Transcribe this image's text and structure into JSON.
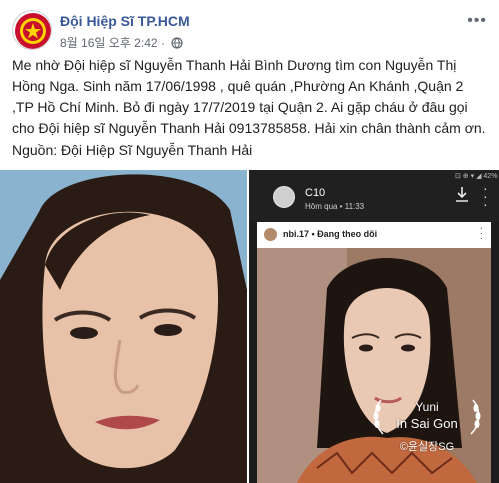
{
  "page": {
    "name": "Đội Hiệp Sĩ TP.HCM",
    "timestamp": "8월 16일 오후 2:42",
    "audience_icon": "globe-icon",
    "more_icon": "ellipsis-icon"
  },
  "post": {
    "body": "Me nhờ Đội hiệp sĩ Nguyễn Thanh Hải Bình Dương tìm con Nguyễn Thị Hồng Nga. Sinh năm 17/06/1998 , quê quán ,Phường An Khánh ,Quận 2 ,TP Hồ Chí Minh. Bỏ đi ngày 17/7/2019 tại Quận 2. Ai gặp cháu ở đâu gọi cho Đội hiệp sĩ Nguyễn Thanh Hải 0913785858. Hải xin chân thành cảm ơn.",
    "source": "Nguồn: Đội Hiệp Sĩ Nguyễn Thanh Hải"
  },
  "screenshot": {
    "status_text": "⊡ ⊕ ▾ ◢ 42% ▮",
    "user": "C10",
    "time": "Hôm qua • 11:33",
    "instagram_user": "nbi.17 • Đang theo dõi",
    "watermark_title": "Yuni",
    "watermark_sub": "In Sai Gon",
    "watermark_credit": "©윤실장SG"
  },
  "colors": {
    "link": "#385898",
    "meta": "#616770",
    "left_photo_bg": "#8ab3cf",
    "screenshot_bg": "#202020"
  }
}
